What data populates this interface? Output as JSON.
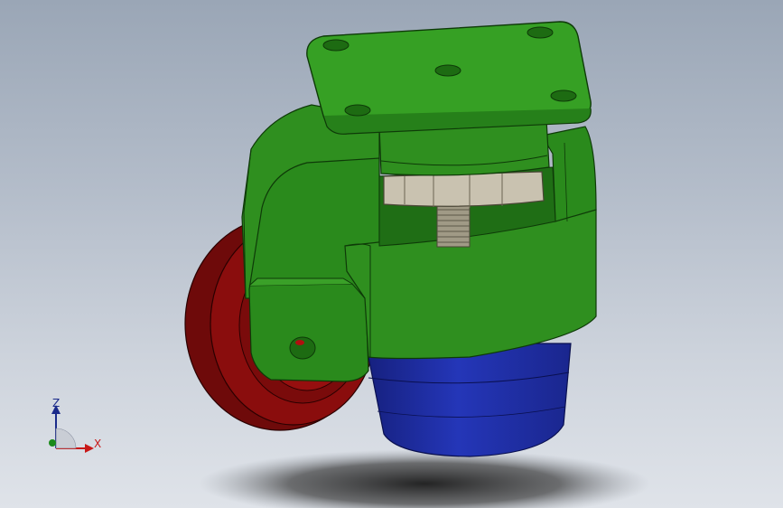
{
  "viewport": {
    "background_top": "#9aa6b6",
    "background_bottom": "#dfe3e9"
  },
  "model": {
    "parts": [
      {
        "name": "mounting-plate",
        "color": "#2f8f1f"
      },
      {
        "name": "housing",
        "color": "#2f8f1f"
      },
      {
        "name": "wheel",
        "color": "#8a0d0d"
      },
      {
        "name": "leveling-foot",
        "color": "#1d2a9c"
      },
      {
        "name": "hex-nut",
        "color": "#c9c2b0"
      },
      {
        "name": "threaded-stem",
        "color": "#a09a86"
      }
    ]
  },
  "triad": {
    "z_label": "Z",
    "x_label": "X",
    "z_color": "#1a2a8a",
    "x_color": "#c81818",
    "y_color": "#1a8a1a"
  }
}
